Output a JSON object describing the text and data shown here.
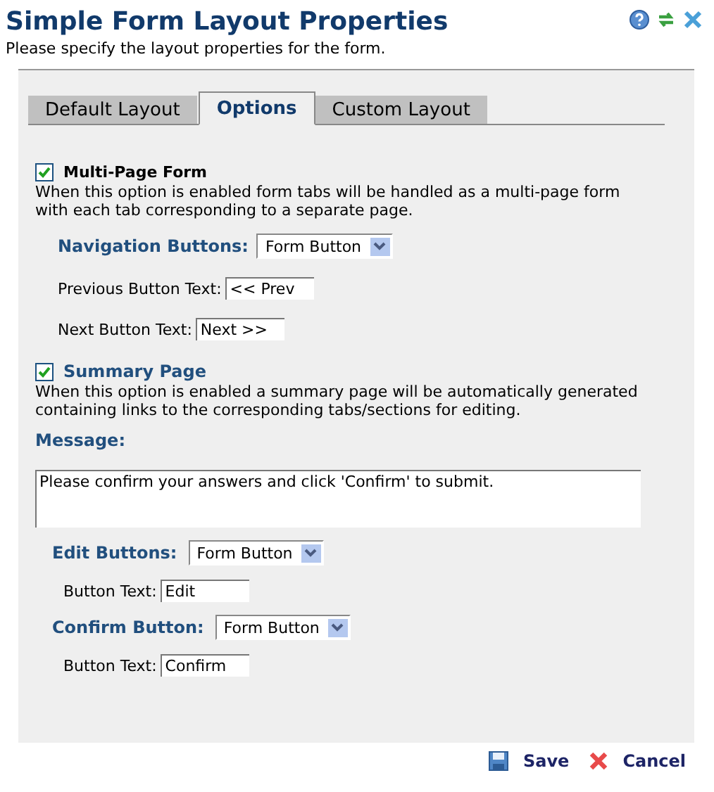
{
  "header": {
    "title": "Simple Form Layout Properties",
    "subtitle": "Please specify the layout properties for the form."
  },
  "tabs": [
    {
      "label": "Default Layout",
      "selected": false
    },
    {
      "label": "Options",
      "selected": true
    },
    {
      "label": "Custom Layout",
      "selected": false
    }
  ],
  "multi_page": {
    "label": "Multi-Page Form",
    "checked": true,
    "description": "When this option is enabled form tabs will be handled as a multi-page form with each tab corresponding to a separate page.",
    "navigation": {
      "label": "Navigation Buttons:",
      "value": "Form Button"
    },
    "fields": [
      {
        "label": "Previous Button Text:",
        "value": "<< Prev"
      },
      {
        "label": "Next Button Text:",
        "value": "Next >>"
      }
    ]
  },
  "summary": {
    "label": "Summary Page",
    "checked": true,
    "description": "When this option is enabled a summary page will be automatically generated containing links to the corresponding tabs/sections for editing.",
    "message_label": "Message:",
    "message": "Please confirm your answers and click 'Confirm' to submit.",
    "groups": [
      {
        "label": "Edit Buttons:",
        "value": "Form Button",
        "text_label": "Button Text:",
        "text_value": "Edit"
      },
      {
        "label": "Confirm Button:",
        "value": "Form Button",
        "text_label": "Button Text:",
        "text_value": "Confirm"
      }
    ]
  },
  "buttons": [
    {
      "kind": "save",
      "label": "Save"
    },
    {
      "kind": "cancel",
      "label": "Cancel"
    }
  ]
}
